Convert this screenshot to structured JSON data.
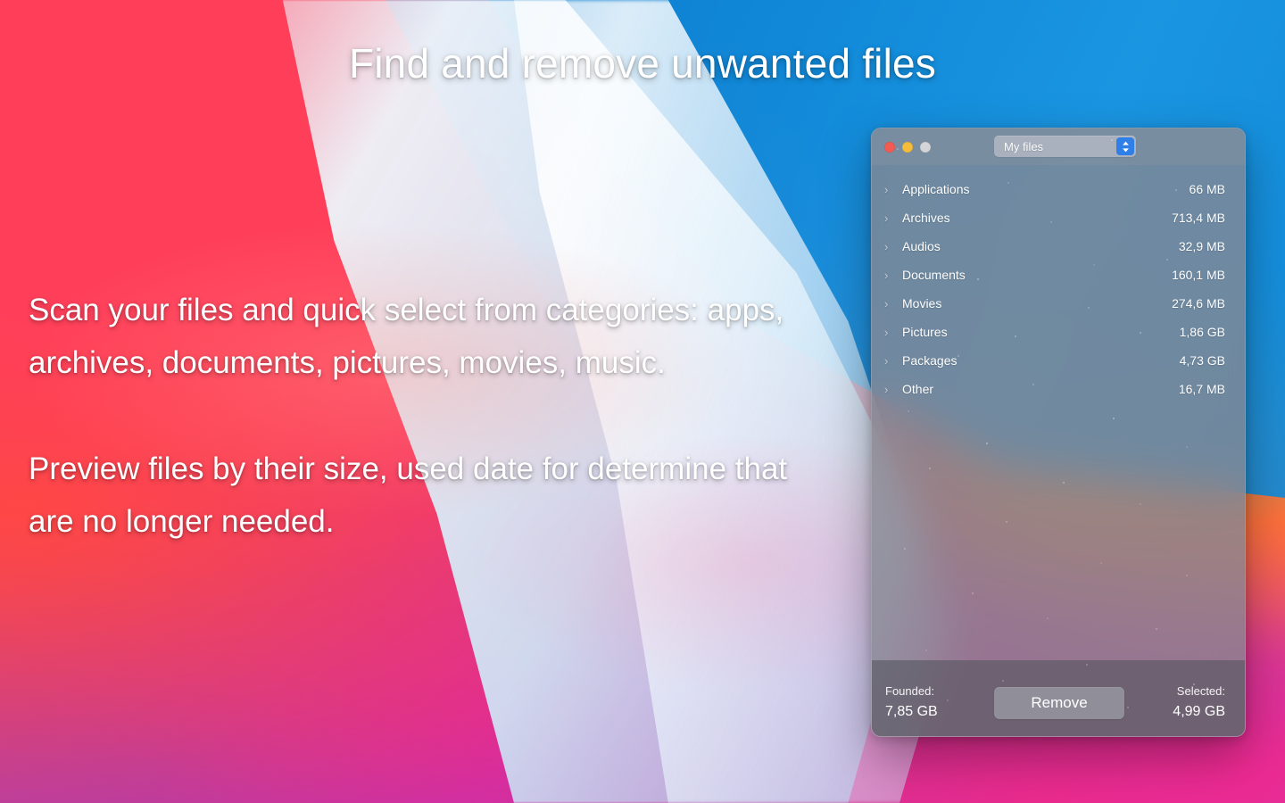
{
  "marketing": {
    "headline": "Find and remove unwanted files",
    "paragraph_1": "Scan your files and quick select from categories: apps, archives, documents, pictures, movies, music.",
    "paragraph_2": "Preview files by their size, used date for determine that are no longer needed."
  },
  "window": {
    "traffic_lights": {
      "close_color": "#f25b52",
      "minimize_color": "#f6bd3b",
      "zoom_color": "#d4d5d6"
    },
    "scope_dropdown": {
      "selected": "My files",
      "options": [
        "My files"
      ],
      "accent_color": "#2f7fe8"
    },
    "file_list": [
      {
        "name": "Applications",
        "size": "66 MB"
      },
      {
        "name": "Archives",
        "size": "713,4 MB"
      },
      {
        "name": "Audios",
        "size": "32,9 MB"
      },
      {
        "name": "Documents",
        "size": "160,1 MB"
      },
      {
        "name": "Movies",
        "size": "274,6 MB"
      },
      {
        "name": "Pictures",
        "size": "1,86 GB"
      },
      {
        "name": "Packages",
        "size": "4,73 GB"
      },
      {
        "name": "Other",
        "size": "16,7 MB"
      }
    ],
    "footer": {
      "founded_label": "Founded:",
      "founded_value": "7,85 GB",
      "remove_label": "Remove",
      "selected_label": "Selected:",
      "selected_value": "4,99 GB"
    }
  }
}
